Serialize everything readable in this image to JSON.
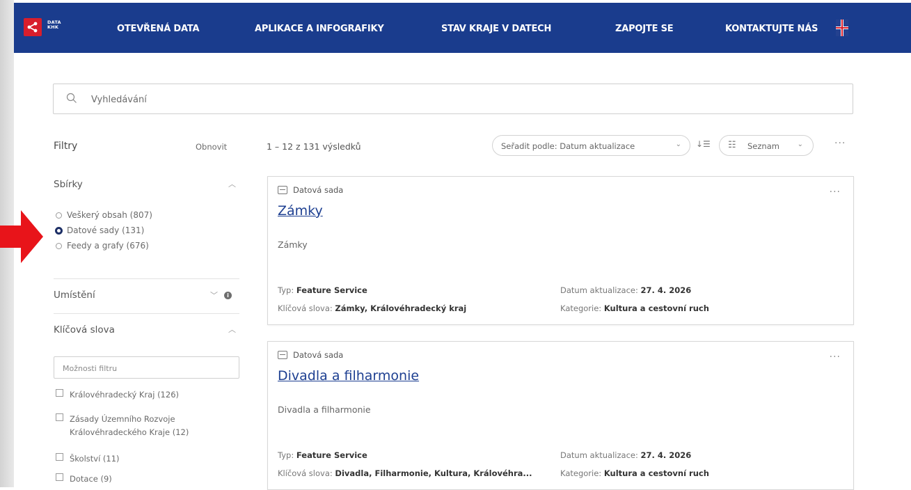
{
  "header": {
    "logo_lines": [
      "DATA",
      "KHK"
    ],
    "nav": [
      {
        "label": "OTEVŘENÁ DATA"
      },
      {
        "label": "APLIKACE A INFOGRAFIKY"
      },
      {
        "label": "STAV KRAJE V DATECH"
      },
      {
        "label": "ZAPOJTE SE"
      },
      {
        "label": "KONTAKTUJTE NÁS"
      }
    ]
  },
  "search": {
    "placeholder": "Vyhledávání"
  },
  "filters": {
    "title": "Filtry",
    "reset_label": "Obnovit",
    "collections": {
      "title": "Sbírky",
      "options": [
        {
          "label": "Veškerý obsah (807)",
          "selected": false
        },
        {
          "label": "Datové sady (131)",
          "selected": true
        },
        {
          "label": "Feedy a grafy (676)",
          "selected": false
        }
      ]
    },
    "location": {
      "title": "Umístění"
    },
    "keywords": {
      "title": "Klíčová slova",
      "placeholder": "Možnosti filtru",
      "options": [
        {
          "label": "Královéhradecký Kraj (126)"
        },
        {
          "label_line1": "Zásady Územního Rozvoje",
          "label_line2": "Královéhradeckého Kraje (12)"
        },
        {
          "label": "Školství (11)"
        },
        {
          "label": "Dotace (9)"
        }
      ]
    }
  },
  "results": {
    "count_text": "1 – 12 z 131 výsledků",
    "sort_label": "Seřadit podle: Datum aktualizace",
    "view_label": "Seznam",
    "items": [
      {
        "type": "Datová sada",
        "title": "Zámky",
        "description": "Zámky",
        "meta_type_label": "Typ:",
        "meta_type_value": "Feature Service",
        "meta_keywords_label": "Klíčová slova:",
        "meta_keywords_value": "Zámky, Královéhradecký kraj",
        "meta_date_label": "Datum aktualizace:",
        "meta_date_value": "27. 4. 2026",
        "meta_category_label": "Kategorie:",
        "meta_category_value": "Kultura a cestovní ruch"
      },
      {
        "type": "Datová sada",
        "title": "Divadla a filharmonie",
        "description": "Divadla a filharmonie",
        "meta_type_label": "Typ:",
        "meta_type_value": "Feature Service",
        "meta_keywords_label": "Klíčová slova:",
        "meta_keywords_value": "Divadla, Filharmonie, Kultura, Královéhra...",
        "meta_date_label": "Datum aktualizace:",
        "meta_date_value": "27. 4. 2026",
        "meta_category_label": "Kategorie:",
        "meta_category_value": "Kultura a cestovní ruch"
      }
    ]
  },
  "colors": {
    "header_bg": "#1a3c8d",
    "accent_red": "#d81e2c",
    "link": "#1d3f91"
  }
}
